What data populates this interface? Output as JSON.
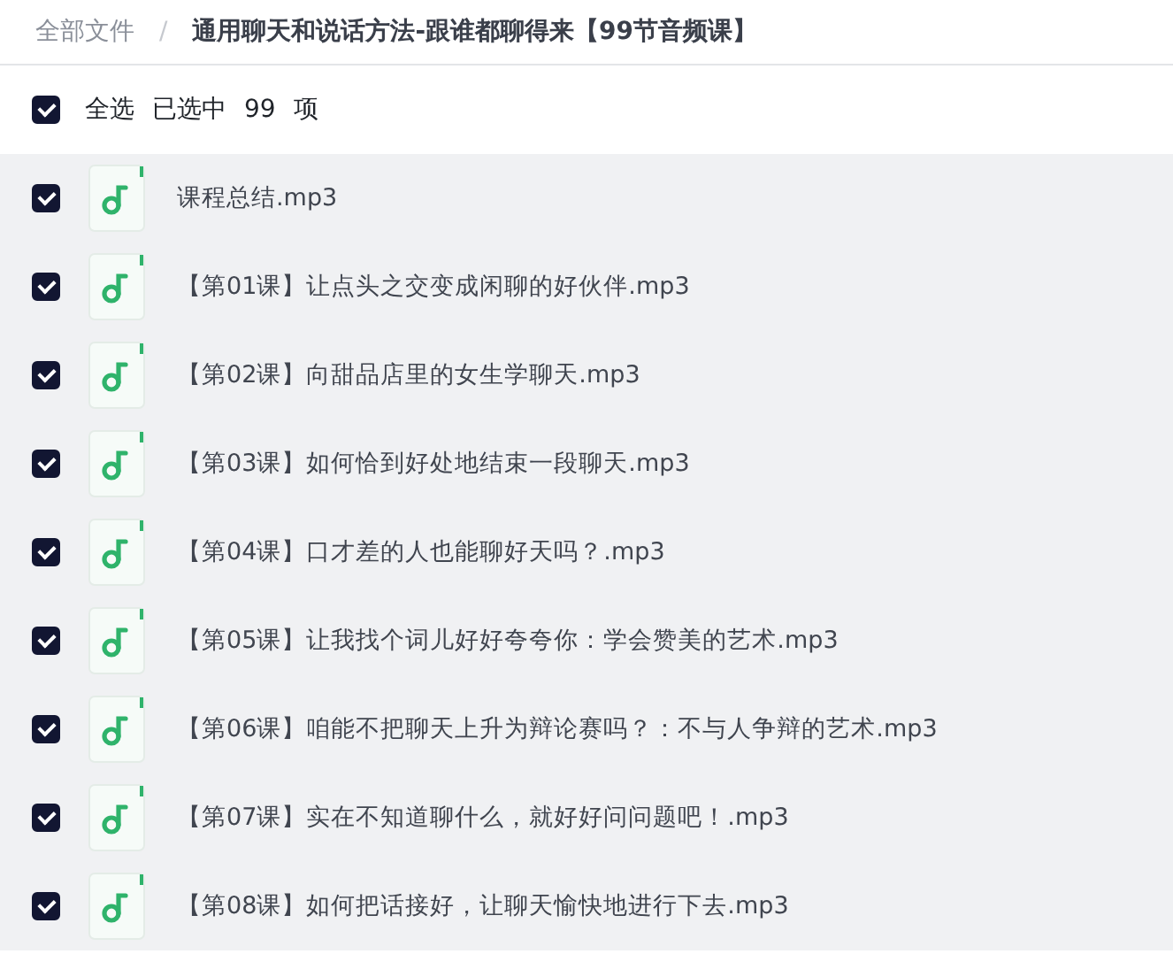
{
  "breadcrumb": {
    "root": "全部文件",
    "separator": "/",
    "current": "通用聊天和说话方法-跟谁都聊得来【99节音频课】"
  },
  "select_bar": {
    "checked": true,
    "select_all": "全选",
    "selected_label": "已选中",
    "count": "99",
    "unit": "项"
  },
  "files": [
    {
      "name": "课程总结.mp3",
      "selected": true
    },
    {
      "name": "【第01课】让点头之交变成闲聊的好伙伴.mp3",
      "selected": true
    },
    {
      "name": "【第02课】向甜品店里的女生学聊天.mp3",
      "selected": true
    },
    {
      "name": "【第03课】如何恰到好处地结束一段聊天.mp3",
      "selected": true
    },
    {
      "name": "【第04课】口才差的人也能聊好天吗？.mp3",
      "selected": true
    },
    {
      "name": "【第05课】让我找个词儿好好夸夸你：学会赞美的艺术.mp3",
      "selected": true
    },
    {
      "name": "【第06课】咱能不把聊天上升为辩论赛吗？：不与人争辩的艺术.mp3",
      "selected": true
    },
    {
      "name": "【第07课】实在不知道聊什么，就好好问问题吧！.mp3",
      "selected": true
    },
    {
      "name": "【第08课】如何把话接好，让聊天愉快地进行下去.mp3",
      "selected": true
    }
  ]
}
